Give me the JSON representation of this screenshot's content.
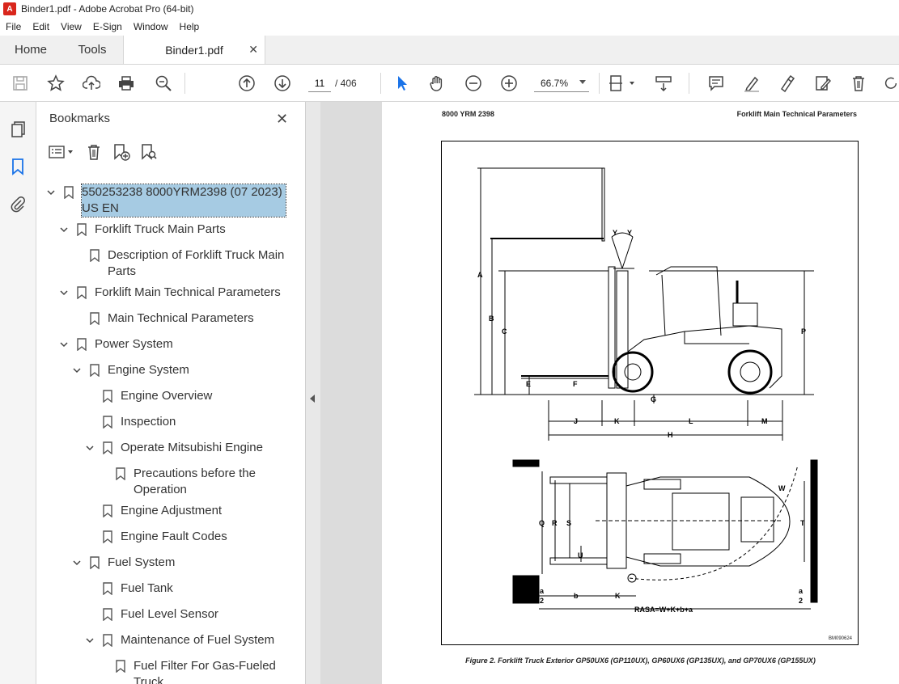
{
  "window": {
    "title": "Binder1.pdf - Adobe Acrobat Pro (64-bit)"
  },
  "menu": [
    "File",
    "Edit",
    "View",
    "E-Sign",
    "Window",
    "Help"
  ],
  "tabs": {
    "home": "Home",
    "tools": "Tools",
    "document": "Binder1.pdf"
  },
  "toolbar": {
    "page_current": "11",
    "page_total": "/ 406",
    "zoom": "66.7%"
  },
  "bookmarks": {
    "title": "Bookmarks",
    "items": [
      {
        "label": "550253238 8000YRM2398 (07 2023) US EN",
        "level": 0,
        "expanded": true,
        "selected": true
      },
      {
        "label": "Forklift Truck Main Parts",
        "level": 1,
        "expanded": true
      },
      {
        "label": "Description of Forklift Truck Main Parts",
        "level": 2
      },
      {
        "label": "Forklift Main Technical Parameters",
        "level": 1,
        "expanded": true
      },
      {
        "label": "Main Technical Parameters",
        "level": 2
      },
      {
        "label": "Power System",
        "level": 1,
        "expanded": true
      },
      {
        "label": "Engine System",
        "level": 2,
        "expanded": true
      },
      {
        "label": "Engine Overview",
        "level": 3
      },
      {
        "label": "Inspection",
        "level": 3
      },
      {
        "label": "Operate Mitsubishi Engine",
        "level": 3,
        "expanded": true
      },
      {
        "label": "Precautions before the Operation",
        "level": 4
      },
      {
        "label": "Engine Adjustment",
        "level": 3
      },
      {
        "label": "Engine Fault Codes",
        "level": 3
      },
      {
        "label": "Fuel System",
        "level": 2,
        "expanded": true
      },
      {
        "label": "Fuel Tank",
        "level": 3
      },
      {
        "label": "Fuel Level Sensor",
        "level": 3
      },
      {
        "label": "Maintenance of Fuel System",
        "level": 3,
        "expanded": true
      },
      {
        "label": "Fuel Filter For Gas-Fueled Truck",
        "level": 4
      }
    ]
  },
  "document": {
    "header_left": "8000 YRM 2398",
    "header_right": "Forklift Main Technical Parameters",
    "caption": "Figure 2. Forklift Truck Exterior GP50UX6 (GP110UX), GP60UX6 (GP135UX), and GP70UX6 (GP155UX)",
    "figure_code": "BM090624",
    "dims": {
      "A": "A",
      "B": "B",
      "C": "C",
      "E": "E",
      "F": "F",
      "G": "G",
      "J": "J",
      "K": "K",
      "L": "L",
      "M": "M",
      "H": "H",
      "P": "P",
      "Y": "Y",
      "Q": "Q",
      "R": "R",
      "S": "S",
      "U": "U",
      "T": "T",
      "W": "W",
      "b": "b",
      "a": "a",
      "two": "2",
      "rasa": "RASA=W+K+b+a"
    }
  }
}
